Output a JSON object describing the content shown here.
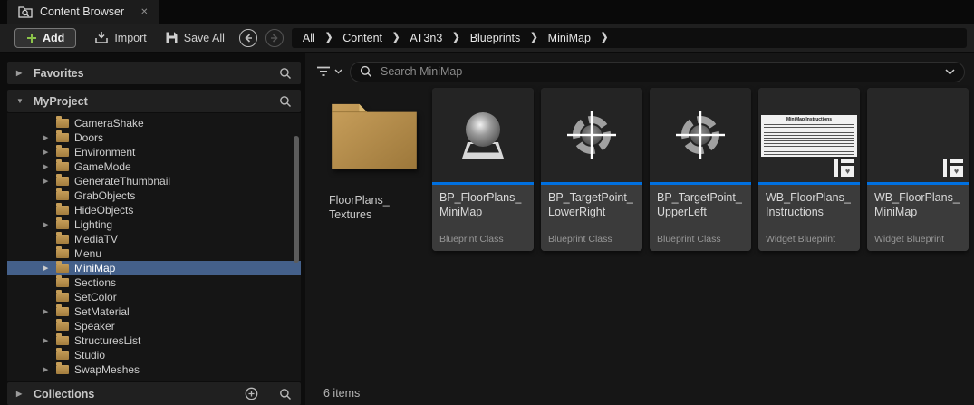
{
  "colors": {
    "accent_blue": "#0070e0",
    "selection_blue": "#44608a",
    "folder_tan": "#bf9551",
    "add_green": "#8bc34a"
  },
  "icons": {
    "close_tab": "✕",
    "breadcrumb_chevron": "❯",
    "collapsed_arrow": "▶",
    "expanded_arrow": "▼",
    "heart": "♥"
  },
  "tab": {
    "title": "Content Browser"
  },
  "toolbar": {
    "add_label": "Add",
    "import_label": "Import",
    "save_all_label": "Save All"
  },
  "breadcrumb": {
    "items": [
      "All",
      "Content",
      "AT3n3",
      "Blueprints",
      "MiniMap"
    ]
  },
  "sidebar": {
    "favorites_label": "Favorites",
    "myproject_label": "MyProject",
    "collections_label": "Collections",
    "tree": [
      {
        "label": "CameraShake",
        "expandable": false,
        "selected": false
      },
      {
        "label": "Doors",
        "expandable": true,
        "selected": false
      },
      {
        "label": "Environment",
        "expandable": true,
        "selected": false
      },
      {
        "label": "GameMode",
        "expandable": true,
        "selected": false
      },
      {
        "label": "GenerateThumbnail",
        "expandable": true,
        "selected": false
      },
      {
        "label": "GrabObjects",
        "expandable": false,
        "selected": false
      },
      {
        "label": "HideObjects",
        "expandable": false,
        "selected": false
      },
      {
        "label": "Lighting",
        "expandable": true,
        "selected": false
      },
      {
        "label": "MediaTV",
        "expandable": false,
        "selected": false
      },
      {
        "label": "Menu",
        "expandable": false,
        "selected": false
      },
      {
        "label": "MiniMap",
        "expandable": true,
        "selected": true
      },
      {
        "label": "Sections",
        "expandable": false,
        "selected": false
      },
      {
        "label": "SetColor",
        "expandable": false,
        "selected": false
      },
      {
        "label": "SetMaterial",
        "expandable": true,
        "selected": false
      },
      {
        "label": "Speaker",
        "expandable": false,
        "selected": false
      },
      {
        "label": "StructuresList",
        "expandable": true,
        "selected": false
      },
      {
        "label": "Studio",
        "expandable": false,
        "selected": false
      },
      {
        "label": "SwapMeshes",
        "expandable": true,
        "selected": false
      }
    ]
  },
  "main": {
    "search_placeholder": "Search MiniMap",
    "status": "6 items",
    "tiles": [
      {
        "kind": "folder",
        "name": "FloorPlans_\nTextures"
      },
      {
        "kind": "blueprint",
        "thumb": "sphere",
        "name": "BP_FloorPlans_\nMiniMap",
        "type": "Blueprint Class"
      },
      {
        "kind": "blueprint",
        "thumb": "target",
        "name": "BP_TargetPoint_\nLowerRight",
        "type": "Blueprint Class"
      },
      {
        "kind": "blueprint",
        "thumb": "target",
        "name": "BP_TargetPoint_\nUpperLeft",
        "type": "Blueprint Class"
      },
      {
        "kind": "widget",
        "thumb": "instructions",
        "thumb_title": "MiniMap Instructions",
        "name": "WB_FloorPlans_\nInstructions",
        "type": "Widget Blueprint"
      },
      {
        "kind": "widget",
        "thumb": "blank",
        "name": "WB_FloorPlans_\nMiniMap",
        "type": "Widget Blueprint"
      }
    ]
  }
}
